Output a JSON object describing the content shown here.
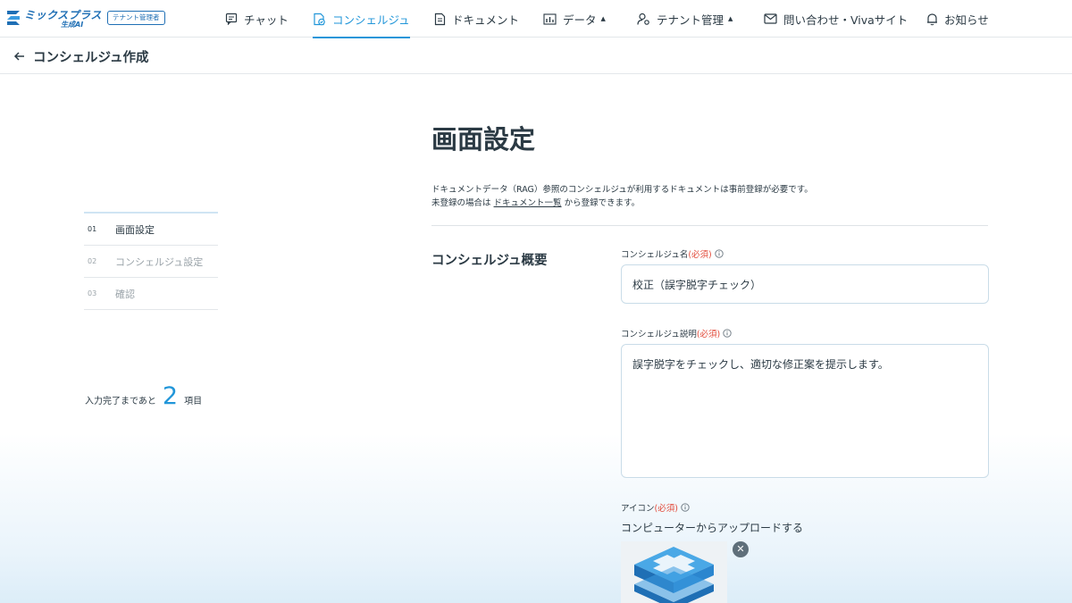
{
  "brand": {
    "name": "ミックスプラス",
    "sub": "生成AI",
    "role_badge": "テナント管理者",
    "accent_color": "#2196d9"
  },
  "nav": {
    "items": [
      {
        "label": "チャット",
        "icon": "chat-icon",
        "active": false
      },
      {
        "label": "コンシェルジュ",
        "icon": "concierge-icon",
        "active": true
      },
      {
        "label": "ドキュメント",
        "icon": "document-icon",
        "active": false
      },
      {
        "label": "データ",
        "icon": "chart-icon",
        "active": false,
        "has_dropdown": true
      },
      {
        "label": "テナント管理",
        "icon": "user-settings-icon",
        "active": false,
        "has_dropdown": true
      },
      {
        "label": "問い合わせ・Vivaサイト",
        "icon": "mail-icon",
        "active": false
      },
      {
        "label": "お知らせ",
        "icon": "bell-icon",
        "active": false
      }
    ]
  },
  "subheader": {
    "title": "コンシェルジュ作成"
  },
  "steps": [
    {
      "num": "01",
      "label": "画面設定",
      "active": true
    },
    {
      "num": "02",
      "label": "コンシェルジュ設定",
      "active": false
    },
    {
      "num": "03",
      "label": "確認",
      "active": false
    }
  ],
  "remaining": {
    "prefix": "入力完了まであと",
    "count": "2",
    "suffix": "項目"
  },
  "main": {
    "page_title": "画面設定",
    "description_line1": "ドキュメントデータ（RAG）参照のコンシェルジュが利用するドキュメントは事前登録が必要です。",
    "description_line2_prefix": "未登録の場合は",
    "description_link": "ドキュメント一覧",
    "description_line2_suffix": "から登録できます。",
    "section_title": "コンシェルジュ概要",
    "required_mark": "(必須)",
    "fields": {
      "name_label": "コンシェルジュ名",
      "name_value": "校正（誤字脱字チェック）",
      "description_label": "コンシェルジュ説明",
      "description_value": "誤字脱字をチェックし、適切な修正案を提示します。",
      "icon_label": "アイコン",
      "upload_text": "コンピューターからアップロードする"
    }
  }
}
